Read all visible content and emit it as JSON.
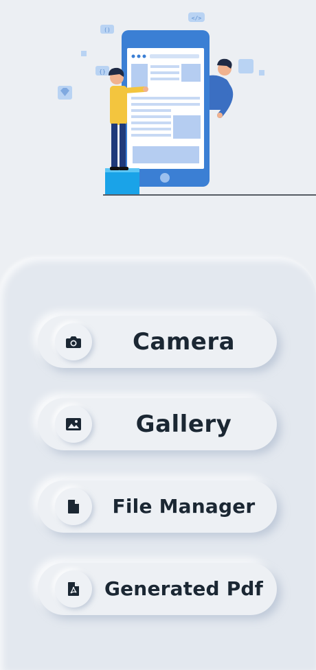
{
  "illustration": {
    "name": "document-scanning-illustration"
  },
  "buttons": [
    {
      "label": "Camera",
      "icon": "camera-icon"
    },
    {
      "label": "Gallery",
      "icon": "image-icon"
    },
    {
      "label": "File Manager",
      "icon": "file-icon"
    },
    {
      "label": "Generated Pdf",
      "icon": "pdf-icon"
    }
  ],
  "colors": {
    "background": "#eceff3",
    "panel": "#e3e8ef",
    "button": "#edf0f4",
    "text": "#1b2733",
    "phone": "#3b7fd4",
    "accent": "#aac8f0"
  }
}
